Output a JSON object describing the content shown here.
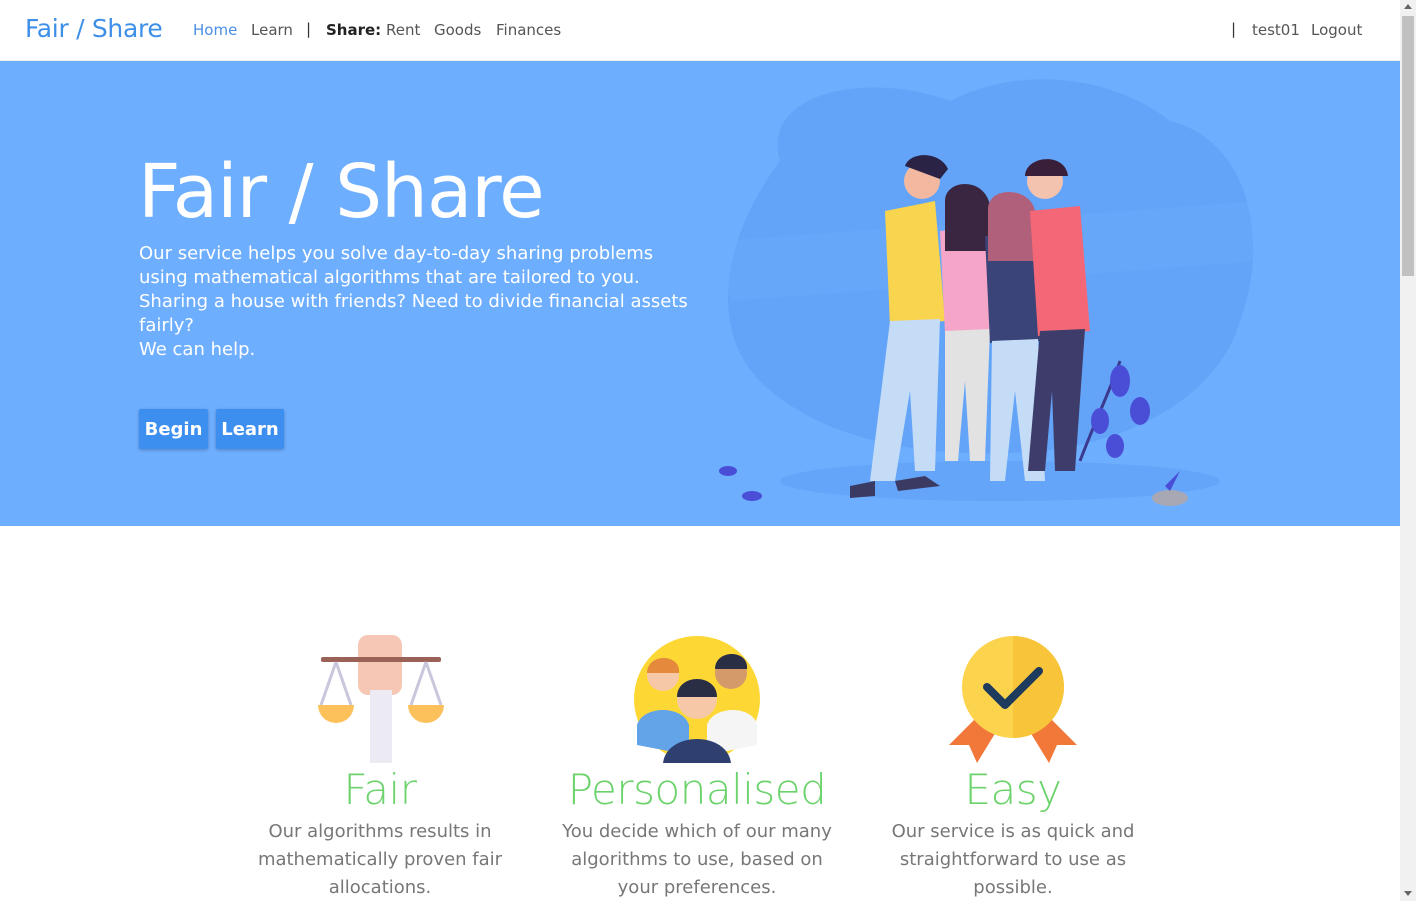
{
  "navbar": {
    "brand": "Fair / Share",
    "links": {
      "home": "Home",
      "learn": "Learn",
      "share": "Share:",
      "rent": "Rent",
      "goods": "Goods",
      "finances": "Finances"
    },
    "separator": "|",
    "username": "test01",
    "logout": "Logout",
    "active_color": "#4b8ee6"
  },
  "hero": {
    "title": "Fair / Share",
    "text_lines": [
      "Our service helps you solve day-to-day sharing problems using mathematical algorithms that are tailored to you. Sharing a house with friends? Need to divide financial assets fairly?",
      "We can help."
    ],
    "begin_button": "Begin",
    "learn_button": "Learn",
    "background": "#6eaeff",
    "button_color": "#3c8fef"
  },
  "features": [
    {
      "icon": "scales-icon",
      "title": "Fair",
      "text": "Our algorithms results in mathematically proven fair allocations."
    },
    {
      "icon": "people-icon",
      "title": "Personalised",
      "text": "You decide which of our many algorithms to use, based on your preferences."
    },
    {
      "icon": "medal-icon",
      "title": "Easy",
      "text": "Our service is as quick and straightforward to use as possible."
    }
  ],
  "feature_title_color": "#6cd36c"
}
